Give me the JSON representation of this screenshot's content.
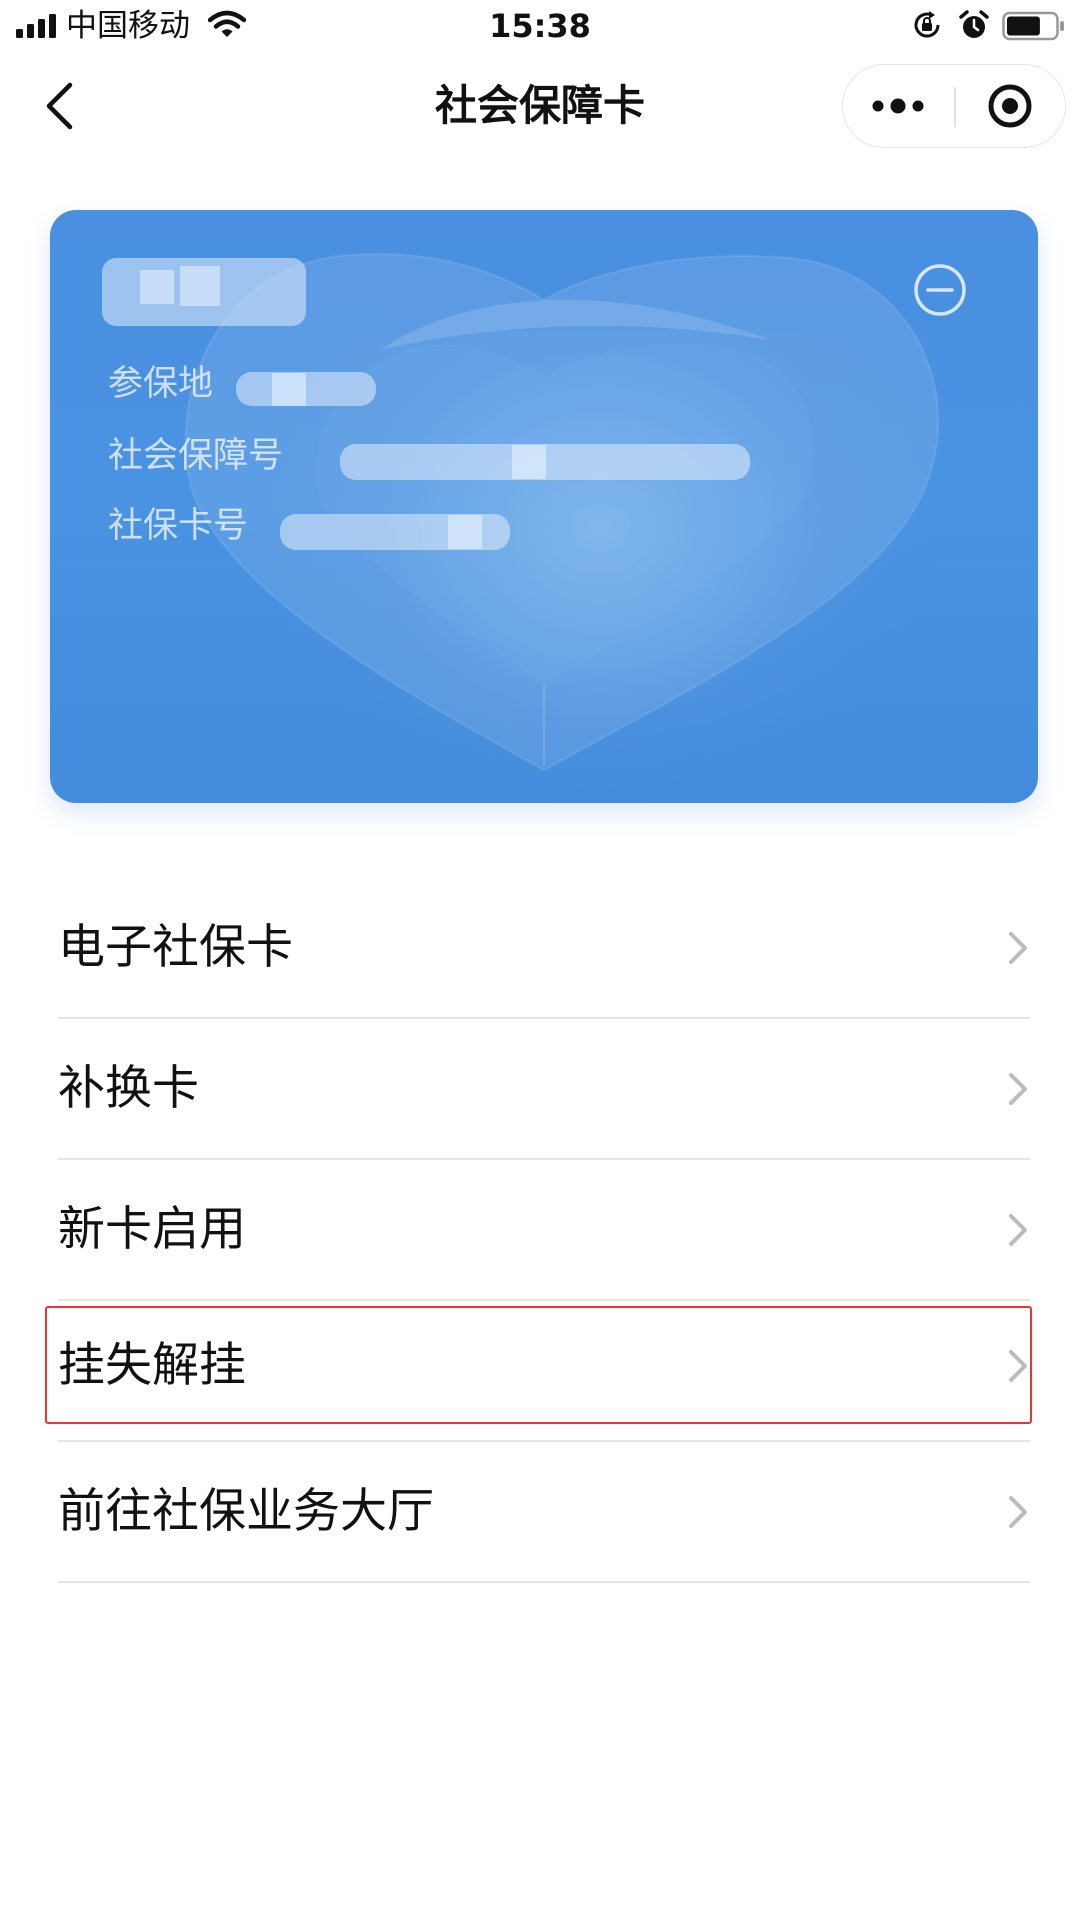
{
  "status_bar": {
    "carrier": "中国移动",
    "time": "15:38",
    "signal_icon": "signal-bars-icon",
    "wifi_icon": "wifi-icon",
    "rotation_lock_icon": "rotation-lock-icon",
    "alarm_icon": "alarm-clock-icon",
    "battery_icon": "battery-icon",
    "battery_level": 0.7
  },
  "nav": {
    "title": "社会保障卡",
    "back_icon": "chevron-left-icon",
    "more_icon": "more-dots-icon",
    "close_icon": "target-circle-icon"
  },
  "card": {
    "remove_icon": "minus-circle-icon",
    "fields": [
      {
        "label": "参保地"
      },
      {
        "label": "社会保障号"
      },
      {
        "label": "社保卡号"
      }
    ],
    "colors": {
      "card_blue": "#4a8fe0"
    }
  },
  "menu": {
    "items": [
      {
        "label": "电子社保卡"
      },
      {
        "label": "补换卡"
      },
      {
        "label": "新卡启用"
      },
      {
        "label": "挂失解挂",
        "highlighted": true
      },
      {
        "label": "前往社保业务大厅"
      }
    ],
    "chevron_icon": "chevron-right-icon",
    "highlight_color": "#e8352e"
  }
}
